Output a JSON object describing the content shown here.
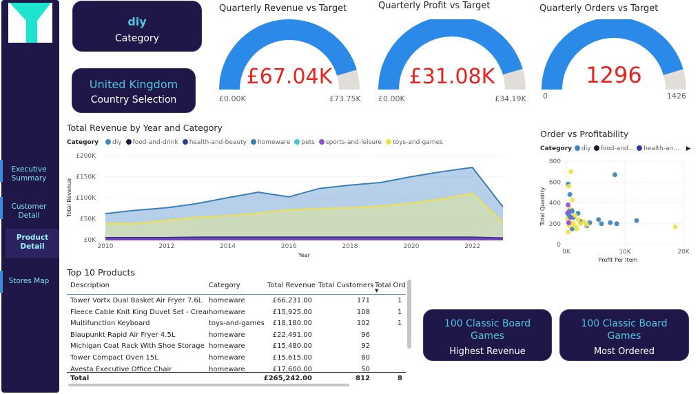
{
  "nav": {
    "items": [
      {
        "label": "Executive\nSummary"
      },
      {
        "label": "Customer\nDetail"
      },
      {
        "label": "Product\nDetail"
      },
      {
        "label": "Stores Map"
      }
    ]
  },
  "cards": {
    "category": {
      "value": "diy",
      "label": "Category"
    },
    "country": {
      "value": "United Kingdom",
      "label": "Country Selection"
    },
    "revenue": {
      "value": "100 Classic Board Games",
      "label": "Highest Revenue"
    },
    "ordered": {
      "value": "100 Classic Board Games",
      "label": "Most Ordered"
    }
  },
  "gauges": [
    {
      "title": "Quarterly Revenue vs Target",
      "value_text": "£67.04K",
      "min": "£0.00K",
      "max": "£73.75K",
      "fraction": 0.909
    },
    {
      "title": "Quarterly Profit vs Target",
      "value_text": "£31.08K",
      "min": "£0.00K",
      "max": "£34.19K",
      "fraction": 0.909
    },
    {
      "title": "Quarterly Orders vs Target",
      "value_text": "1296",
      "min": "0",
      "max": "1426",
      "fraction": 0.909
    }
  ],
  "colors": {
    "diy": "#3c87c4",
    "food-and-drink": "#1a1a3e",
    "health-and-beauty": "#2f3c9c",
    "homeware": "#3a7fb8",
    "pets": "#40c8d8",
    "sports-and-leisure": "#8d4fdb",
    "toys-and-games": "#f0e04a",
    "gauge_fill": "#2b8ae8",
    "gauge_bg": "#e1ddd9"
  },
  "chart_data": [
    {
      "type": "area",
      "title": "Total Revenue by Year and Category",
      "legend_title": "Category",
      "legend": [
        "diy",
        "food-and-drink",
        "health-and-beauty",
        "homeware",
        "pets",
        "sports-and-leisure",
        "toys-and-games"
      ],
      "xlabel": "Year",
      "ylabel": "Total Revenue",
      "x": [
        2010,
        2011,
        2012,
        2013,
        2014,
        2015,
        2016,
        2017,
        2018,
        2019,
        2020,
        2021,
        2022,
        2023
      ],
      "x_ticks": [
        "2010",
        "2012",
        "2014",
        "2016",
        "2018",
        "2020",
        "2022"
      ],
      "y_ticks": [
        "£0K",
        "£50K",
        "£100K",
        "£150K",
        "£200K"
      ],
      "ylim": [
        0,
        200
      ],
      "series": [
        {
          "name": "homeware",
          "values": [
            62,
            70,
            76,
            86,
            100,
            113,
            102,
            122,
            130,
            136,
            150,
            162,
            172,
            78
          ]
        },
        {
          "name": "toys-and-games",
          "values": [
            38,
            39,
            46,
            53,
            57,
            63,
            71,
            74,
            76,
            80,
            87,
            97,
            110,
            42
          ]
        },
        {
          "name": "sports-and-leisure",
          "values": [
            5,
            5,
            5,
            6,
            6,
            6,
            6,
            6,
            6,
            6,
            6,
            6,
            6,
            4
          ]
        }
      ]
    },
    {
      "type": "scatter",
      "title": "Order vs Profitability",
      "legend_title": "Category",
      "legend": [
        "diy",
        "food-and...",
        "health-an..."
      ],
      "xlabel": "Profit Per Item",
      "ylabel": "Total Quantity",
      "x_ticks": [
        "0K",
        "10K",
        "20K"
      ],
      "y_ticks": [
        "0",
        "200",
        "400",
        "600",
        "800"
      ],
      "xlim": [
        0,
        20000
      ],
      "ylim": [
        0,
        800
      ],
      "series": [
        {
          "name": "homeware",
          "points": [
            [
              500,
              200
            ],
            [
              1200,
              260
            ],
            [
              2500,
              220
            ],
            [
              4000,
              210
            ],
            [
              5500,
              240
            ],
            [
              6000,
              200
            ],
            [
              7500,
              210
            ],
            [
              8300,
              670
            ],
            [
              8600,
              200
            ],
            [
              12000,
              230
            ],
            [
              1000,
              150
            ],
            [
              3500,
              180
            ],
            [
              300,
              580
            ],
            [
              600,
              480
            ],
            [
              2000,
              300
            ],
            [
              900,
              330
            ]
          ]
        },
        {
          "name": "toys-and-games",
          "points": [
            [
              200,
              250
            ],
            [
              500,
              180
            ],
            [
              800,
              210
            ],
            [
              1200,
              200
            ],
            [
              1600,
              170
            ],
            [
              2000,
              240
            ],
            [
              2400,
              200
            ],
            [
              3000,
              220
            ],
            [
              3500,
              190
            ],
            [
              800,
              700
            ],
            [
              400,
              560
            ],
            [
              1000,
              430
            ],
            [
              600,
              340
            ],
            [
              1500,
              280
            ],
            [
              18600,
              170
            ],
            [
              300,
              120
            ],
            [
              1800,
              150
            ]
          ]
        },
        {
          "name": "sports-and-leisure",
          "points": [
            [
              300,
              380
            ],
            [
              500,
              320
            ],
            [
              200,
              300
            ],
            [
              700,
              260
            ],
            [
              400,
              210
            ]
          ]
        },
        {
          "name": "diy",
          "points": [
            [
              500,
              280
            ],
            [
              1000,
              320
            ]
          ]
        }
      ]
    }
  ],
  "table": {
    "title": "Top 10 Products",
    "columns": [
      "Description",
      "Category",
      "Total Revenue",
      "Total Customers",
      "Total Orde"
    ],
    "rows": [
      [
        "Tower Vortx Dual Basket Air Fryer 7.6L",
        "homeware",
        "£66,231.00",
        "171",
        "1"
      ],
      [
        "Fleece Cable Knit King Duvet Set - Cream",
        "homeware",
        "£15,925.00",
        "108",
        "1"
      ],
      [
        "Multifunction Keyboard",
        "toys-and-games",
        "£18,180.00",
        "102",
        "1"
      ],
      [
        "Blaupunkt Rapid Air Fryer 4.5L",
        "homeware",
        "£22,491.00",
        "96",
        ""
      ],
      [
        "Michigan Coat Rack With Shoe Storage",
        "homeware",
        "£15,480.00",
        "92",
        ""
      ],
      [
        "Tower Compact Oven 15L",
        "homeware",
        "£15,615.00",
        "80",
        ""
      ],
      [
        "Avesta Executive Office Chair",
        "homeware",
        "£17,600.00",
        "50",
        ""
      ]
    ],
    "total": {
      "label": "Total",
      "revenue": "£265,242.00",
      "customers": "812",
      "orders": "8"
    }
  }
}
